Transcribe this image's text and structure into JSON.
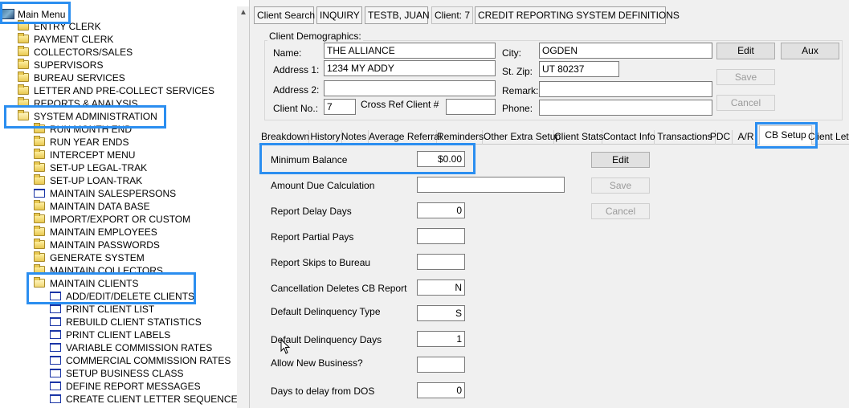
{
  "tree": {
    "root": "Main Menu",
    "items": [
      {
        "label": "ENTRY CLERK",
        "icon": "folder"
      },
      {
        "label": "PAYMENT CLERK",
        "icon": "folder"
      },
      {
        "label": "COLLECTORS/SALES",
        "icon": "folder"
      },
      {
        "label": "SUPERVISORS",
        "icon": "folder"
      },
      {
        "label": "BUREAU SERVICES",
        "icon": "folder"
      },
      {
        "label": "LETTER AND PRE-COLLECT SERVICES",
        "icon": "folder"
      },
      {
        "label": "REPORTS & ANALYSIS",
        "icon": "folder"
      },
      {
        "label": "SYSTEM ADMINISTRATION",
        "icon": "folder-open"
      },
      {
        "label": "RUN MONTH END",
        "icon": "folder"
      },
      {
        "label": "RUN YEAR ENDS",
        "icon": "folder"
      },
      {
        "label": "INTERCEPT MENU",
        "icon": "folder"
      },
      {
        "label": "SET-UP LEGAL-TRAK",
        "icon": "folder"
      },
      {
        "label": "SET-UP LOAN-TRAK",
        "icon": "folder"
      },
      {
        "label": "MAINTAIN SALESPERSONS",
        "icon": "leaf"
      },
      {
        "label": "MAINTAIN DATA BASE",
        "icon": "folder"
      },
      {
        "label": "IMPORT/EXPORT OR CUSTOM",
        "icon": "folder"
      },
      {
        "label": "MAINTAIN EMPLOYEES",
        "icon": "folder"
      },
      {
        "label": "MAINTAIN PASSWORDS",
        "icon": "folder"
      },
      {
        "label": "GENERATE SYSTEM",
        "icon": "folder"
      },
      {
        "label": "MAINTAIN COLLECTORS",
        "icon": "folder"
      },
      {
        "label": "MAINTAIN CLIENTS",
        "icon": "folder-open"
      },
      {
        "label": "ADD/EDIT/DELETE CLIENTS",
        "icon": "leaf"
      },
      {
        "label": "PRINT CLIENT LIST",
        "icon": "leaf"
      },
      {
        "label": "REBUILD CLIENT STATISTICS",
        "icon": "leaf"
      },
      {
        "label": "PRINT CLIENT LABELS",
        "icon": "leaf"
      },
      {
        "label": "VARIABLE COMMISSION RATES",
        "icon": "leaf"
      },
      {
        "label": "COMMERCIAL COMMISSION RATES",
        "icon": "leaf"
      },
      {
        "label": "SETUP BUSINESS CLASS",
        "icon": "leaf"
      },
      {
        "label": "DEFINE REPORT MESSAGES",
        "icon": "leaf"
      },
      {
        "label": "CREATE CLIENT LETTER SEQUENCES",
        "icon": "leaf"
      }
    ]
  },
  "toolbar": {
    "client_search": "Client Search",
    "inquiry": "INQUIRY",
    "debtor": "TESTB, JUAN",
    "client": "Client: 7",
    "title": "CREDIT REPORTING SYSTEM DEFINITIONS"
  },
  "demographics": {
    "group_title": "Client Demographics:",
    "name_label": "Name:",
    "name": "THE ALLIANCE",
    "addr1_label": "Address 1:",
    "addr1": "1234 MY ADDY",
    "addr2_label": "Address 2:",
    "addr2": "",
    "clientno_label": "Client No.:",
    "clientno": "7",
    "crossref_label": "Cross Ref Client #",
    "crossref": "",
    "city_label": "City:",
    "city": "OGDEN",
    "stzip_label": "St. Zip:",
    "stzip": "UT 80237",
    "remark_label": "Remark:",
    "remark": "",
    "phone_label": "Phone:",
    "phone": "",
    "edit": "Edit",
    "aux": "Aux",
    "save": "Save",
    "cancel": "Cancel"
  },
  "tabs": [
    "Breakdown",
    "History",
    "Notes",
    "Average Referral",
    "Reminders",
    "Other Extra Setup",
    "Client Stats",
    "Contact Info",
    "Transactions",
    "PDC",
    "A/R",
    "CB Setup",
    "Client Letter"
  ],
  "active_tab": "CB Setup",
  "cb": {
    "min_balance_label": "Minimum Balance",
    "min_balance": "$0.00",
    "amount_due_label": "Amount Due Calculation",
    "amount_due": "",
    "delay_days_label": "Report Delay Days",
    "delay_days": "0",
    "partial_label": "Report Partial Pays",
    "partial": "",
    "skips_label": "Report Skips to Bureau",
    "skips": "",
    "cancel_label": "Cancellation Deletes CB Report",
    "cancel_val": "N",
    "delinq_type_label": "Default Delinquency Type",
    "delinq_type": "S",
    "delinq_days_label": "Default Delinquency Days",
    "delinq_days": "1",
    "allow_label": "Allow New Business?",
    "allow": "",
    "dos_label": "Days to delay from DOS",
    "dos": "0",
    "edit": "Edit",
    "save": "Save",
    "cancel": "Cancel"
  },
  "highlight_color": "#2b8ef0"
}
